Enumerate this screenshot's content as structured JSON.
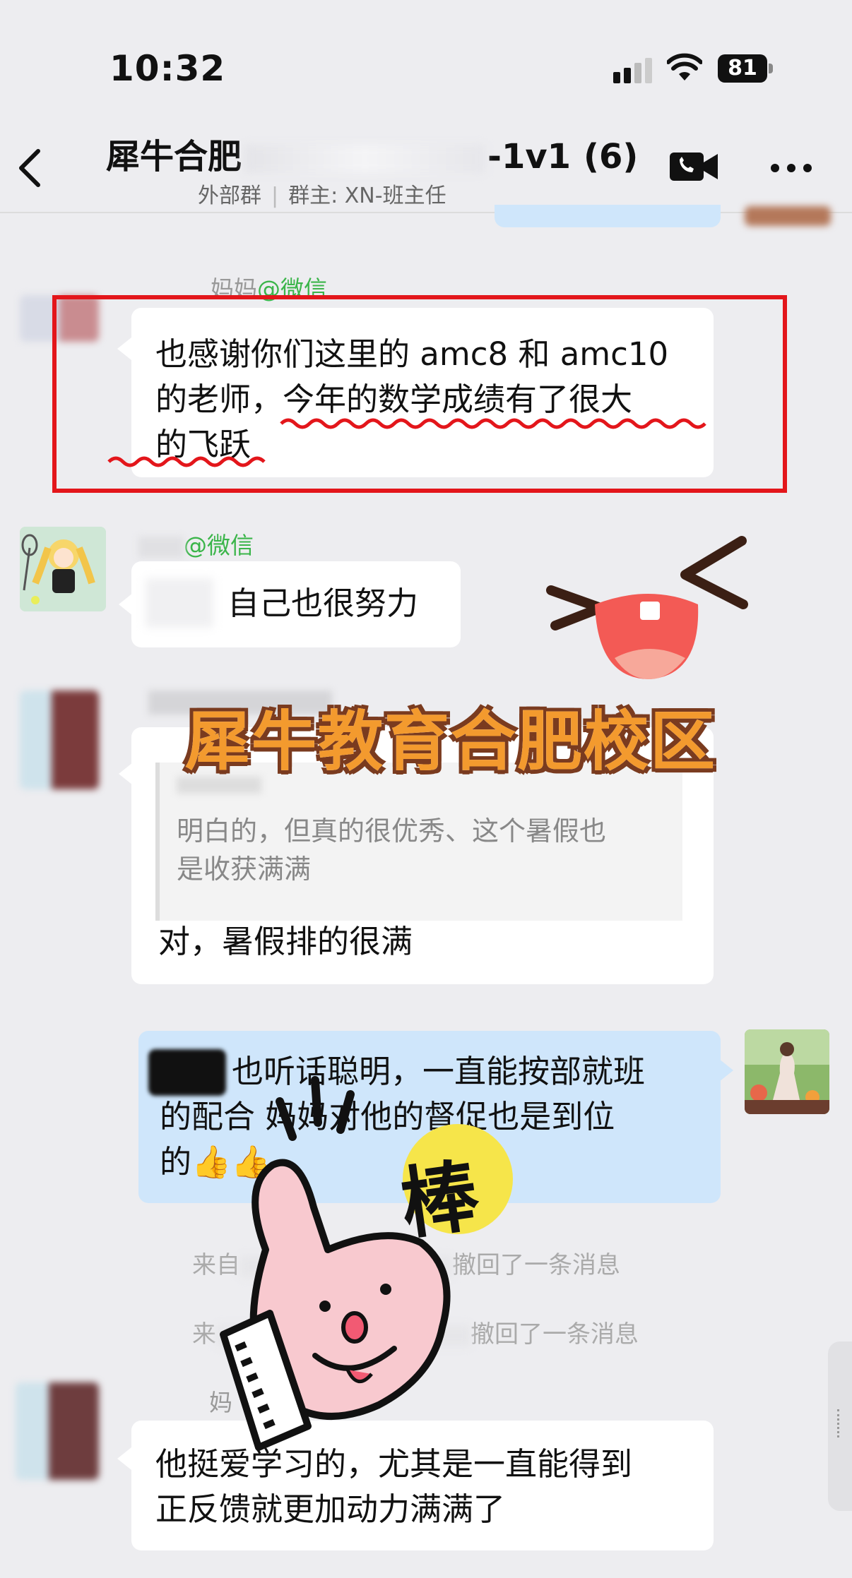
{
  "status_bar": {
    "time": "10:32",
    "battery": "81"
  },
  "header": {
    "title_prefix": "犀牛合肥",
    "title_suffix": "-1v1",
    "member_count": "(6)",
    "group_type": "外部群",
    "owner_label": "群主: XN-班主任"
  },
  "messages": [
    {
      "sender": "妈妈",
      "source": "@微信",
      "text_line1": "也感谢你们这里的 amc8 和 amc10",
      "text_line2": "的老师，今年的数学成绩有了很大",
      "text_line3": "的飞跃"
    },
    {
      "sender": "",
      "source": "@微信",
      "text": "自己也很努力"
    },
    {
      "quote_line1": "明白的，但真的很优秀、这个暑假也",
      "quote_line2": "是收获满满",
      "text": "对，暑假排的很满"
    },
    {
      "text_line1": "也听话聪明，一直能按部就班",
      "text_line2": "的配合 妈妈对他的督促也是到位",
      "text_line3": "的👍👍"
    },
    {
      "sender": "妈",
      "text_line1": "他挺爱学习的，尤其是一直能得到",
      "text_line2": "正反馈就更加动力满满了"
    }
  ],
  "system_messages": [
    {
      "prefix": "来自",
      "text": "撤回了一条消息"
    },
    {
      "prefix": "来",
      "text": "撤回了一条消息"
    }
  ],
  "watermark": {
    "text": "犀牛教育合肥校区"
  },
  "sticker": {
    "text": "棒"
  },
  "colors": {
    "highlight_box": "#e3161b",
    "wavy_underline": "#e3161b",
    "my_bubble": "#cfe6fb",
    "wechat_green": "#3bb54a",
    "watermark_orange": "#f39a2e"
  }
}
